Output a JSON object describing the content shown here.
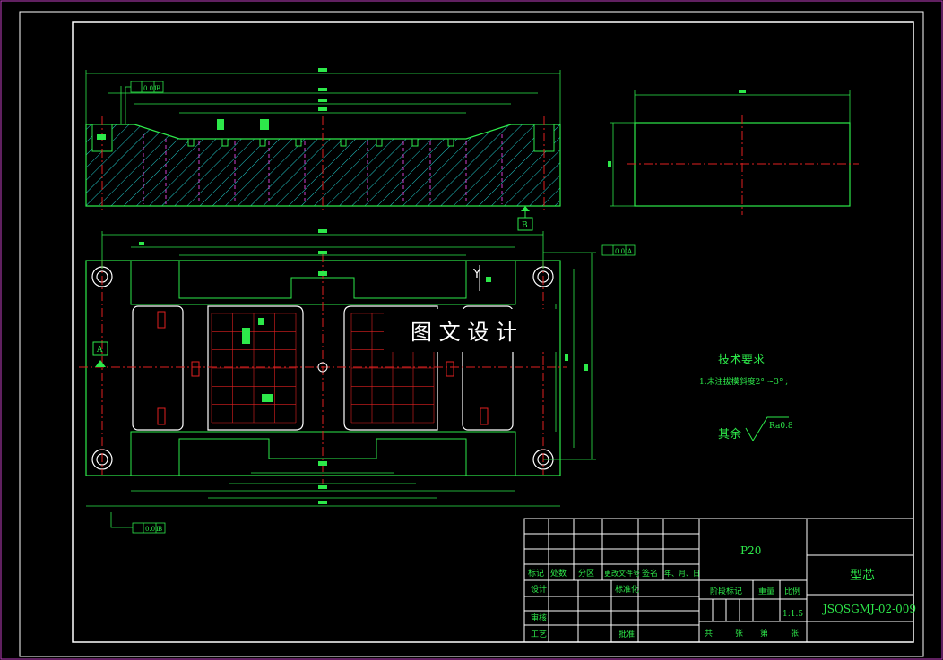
{
  "colors": {
    "background": "#000000",
    "frame": "#ffffff",
    "geometry": "#2de84a",
    "centerline": "#e02020",
    "hidden": "#d040d0",
    "hatch": "#20c8c8",
    "border_accent": "#c040c0"
  },
  "drawing": {
    "tolerance_top": "0.01",
    "tolerance_top_datum": "B",
    "tolerance_side": "0.01",
    "tolerance_side_datum": "A",
    "tolerance_bottom": "0.01",
    "tolerance_bottom_datum": "B",
    "datum_a": "A",
    "datum_b": "B",
    "marker_y": "Y",
    "watermark": "图 文 设 计"
  },
  "notes": {
    "heading": "技术要求",
    "line1": "1.未注拔模斜度2° ~3° ;",
    "roughness_label": "其余",
    "roughness_value": "Ra0.8"
  },
  "title_block": {
    "material": "P20",
    "part_name": "型芯",
    "drawing_no": "JSQSGMJ-02-009",
    "scale": "1:1.5",
    "h_mark": "标记",
    "h_count": "处数",
    "h_zone": "分区",
    "h_doc": "更改文件号",
    "h_sign": "签名",
    "h_date": "年、月、日",
    "design": "设计",
    "standard": "标准化",
    "stage": "阶段标记",
    "weight": "重量",
    "ratio": "比例",
    "review": "审核",
    "process": "工艺",
    "approve": "批准",
    "total": "共",
    "sheet": "张",
    "no": "第",
    "sheet2": "张"
  }
}
